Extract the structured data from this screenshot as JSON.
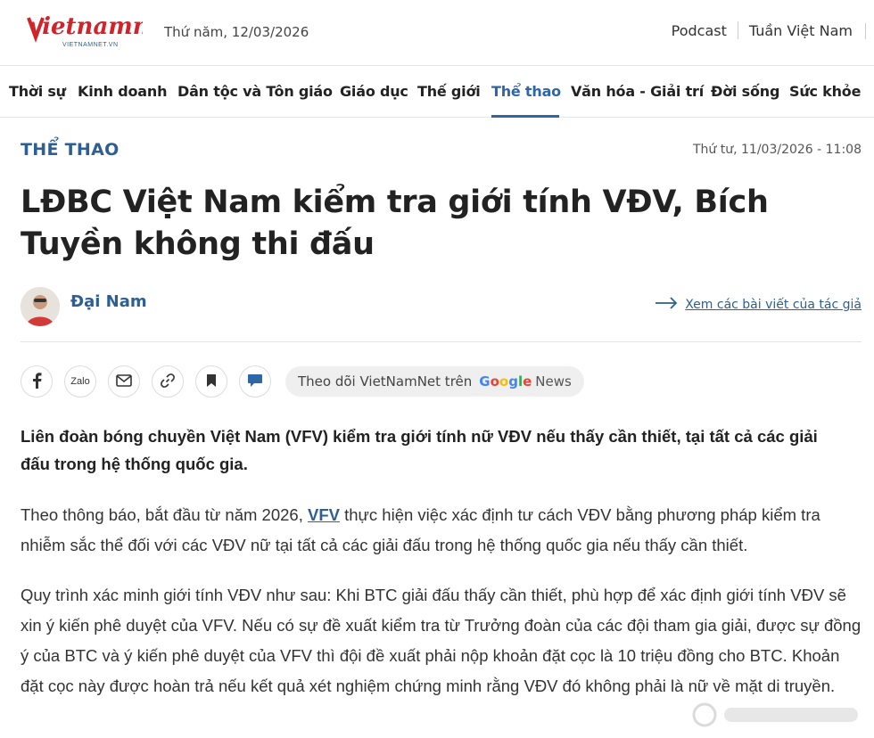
{
  "header": {
    "logo_text": "vietnamnet",
    "logo_sub": "VIETNAMNET.VN",
    "date": "Thứ năm, 12/03/2026",
    "links": [
      "Podcast",
      "Tuần Việt Nam"
    ]
  },
  "nav": {
    "items": [
      {
        "label": "Thời sự"
      },
      {
        "label": "Kinh doanh"
      },
      {
        "label": "Dân tộc và Tôn giáo"
      },
      {
        "label": "Giáo dục"
      },
      {
        "label": "Thế giới"
      },
      {
        "label": "Thể thao",
        "active": true
      },
      {
        "label": "Văn hóa - Giải trí"
      },
      {
        "label": "Đời sống"
      },
      {
        "label": "Sức khỏe"
      }
    ]
  },
  "article": {
    "category": "THỂ THAO",
    "published": "Thứ tư, 11/03/2026 - 11:08",
    "title": "LĐBC Việt Nam kiểm tra giới tính VĐV, Bích Tuyền không thi đấu",
    "author": "Đại Nam",
    "author_link": "Xem các bài viết của tác giả",
    "follow_text": "Theo dõi VietNamNet trên",
    "follow_brand": "Google",
    "follow_brand_suffix": "News",
    "lead": "Liên đoàn bóng chuyền Việt Nam (VFV) kiểm tra giới tính nữ VĐV nếu thấy cần thiết, tại tất cả các giải đấu trong hệ thống quốc gia.",
    "p1_before": "Theo thông báo, bắt đầu từ năm 2026, ",
    "p1_link": "VFV",
    "p1_after": " thực hiện việc xác định tư cách VĐV bằng phương pháp kiểm tra nhiễm sắc thể đối với các VĐV nữ tại tất cả các giải đấu trong hệ thống quốc gia nếu thấy cần thiết.",
    "p2": "Quy trình xác minh giới tính VĐV như sau: Khi BTC giải đấu thấy cần thiết, phù hợp để xác định giới tính VĐV sẽ xin ý kiến phê duyệt của VFV. Nếu có sự đề xuất kiểm tra từ Trưởng đoàn của các đội tham gia giải, được sự đồng ý của BTC và ý kiến phê duyệt của VFV thì đội đề xuất phải nộp khoản đặt cọc là 10 triệu đồng cho BTC. Khoản đặt cọc này được hoàn trả nếu kết quả xét nghiệm chứng minh rằng VĐV đó không phải là nữ về mặt di truyền."
  },
  "share": {
    "zalo_label": "Zalo",
    "icons": [
      "facebook-icon",
      "zalo-icon",
      "mail-icon",
      "link-icon",
      "bookmark-icon",
      "comment-icon"
    ]
  },
  "colors": {
    "brand_red": "#d2232a",
    "accent_blue": "#2d67a7",
    "link_blue": "#2d5f94"
  }
}
